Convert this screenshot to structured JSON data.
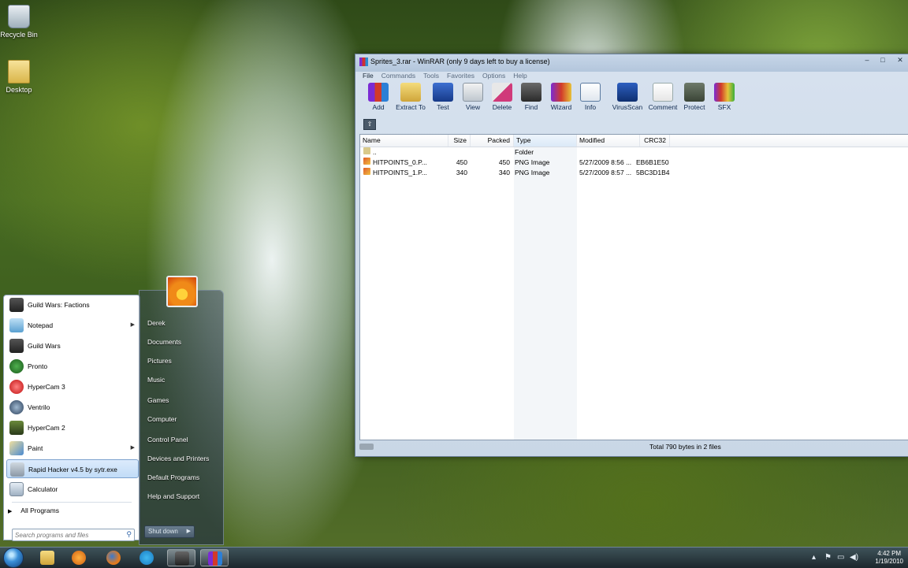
{
  "desktop": {
    "icons": [
      {
        "label": "Recycle Bin",
        "icon": "recycle-bin-icon"
      },
      {
        "label": "Desktop",
        "icon": "folder-icon"
      }
    ]
  },
  "winrar": {
    "title": "Sprites_3.rar - WinRAR (only 9 days left to buy a license)",
    "window_buttons": {
      "minimize": "–",
      "maximize": "□",
      "close": "✕"
    },
    "menu": [
      "File",
      "Commands",
      "Tools",
      "Favorites",
      "Options",
      "Help"
    ],
    "toolbar": [
      "Add",
      "Extract To",
      "Test",
      "View",
      "Delete",
      "Find",
      "Wizard",
      "Info",
      "VirusScan",
      "Comment",
      "Protect",
      "SFX"
    ],
    "path_up_glyph": "⇧",
    "columns": [
      "Name",
      "Size",
      "Packed",
      "Type",
      "Modified",
      "CRC32"
    ],
    "rows": [
      {
        "name": "..",
        "size": "",
        "packed": "",
        "type": "Folder",
        "modified": "",
        "crc": ""
      },
      {
        "name": "HITPOINTS_0.P...",
        "size": "450",
        "packed": "450",
        "type": "PNG Image",
        "modified": "5/27/2009 8:56 ...",
        "crc": "EB6B1E50"
      },
      {
        "name": "HITPOINTS_1.P...",
        "size": "340",
        "packed": "340",
        "type": "PNG Image",
        "modified": "5/27/2009 8:57 ...",
        "crc": "5BC3D1B4"
      }
    ],
    "status": "Total 790 bytes in 2 files"
  },
  "start_menu": {
    "programs": [
      {
        "label": "Guild Wars: Factions",
        "icon": "guild-wars-factions-icon",
        "submenu": false
      },
      {
        "label": "Notepad",
        "icon": "notepad-icon",
        "submenu": true
      },
      {
        "label": "Guild Wars",
        "icon": "guild-wars-icon",
        "submenu": false
      },
      {
        "label": "Pronto",
        "icon": "pronto-icon",
        "submenu": false
      },
      {
        "label": "HyperCam 3",
        "icon": "hypercam-icon",
        "submenu": false
      },
      {
        "label": "Ventrilo",
        "icon": "ventrilo-icon",
        "submenu": false
      },
      {
        "label": "HyperCam 2",
        "icon": "hypercam-icon",
        "submenu": false
      },
      {
        "label": "Paint",
        "icon": "paint-icon",
        "submenu": true
      },
      {
        "label": "Rapid Hacker v4.5 by sytr.exe",
        "icon": "application-icon",
        "submenu": false
      },
      {
        "label": "Calculator",
        "icon": "calculator-icon",
        "submenu": false
      }
    ],
    "submenu_arrow": "▶",
    "all_programs": "All Programs",
    "search_placeholder": "Search programs and files",
    "search_glyph": "⚲",
    "right": [
      "Derek",
      "Documents",
      "Pictures",
      "Music",
      "Games",
      "Computer",
      "Control Panel",
      "Devices and Printers",
      "Default Programs",
      "Help and Support"
    ],
    "shutdown": "Shut down",
    "shutdown_arrow": "▶"
  },
  "taskbar": {
    "pinned": [
      "explorer",
      "media-player",
      "firefox",
      "skype",
      "guild-wars",
      "winrar"
    ],
    "tray_glyphs": [
      "▴",
      "⚑",
      "▭",
      "◀)"
    ],
    "time": "4:42 PM",
    "date": "1/19/2010"
  }
}
